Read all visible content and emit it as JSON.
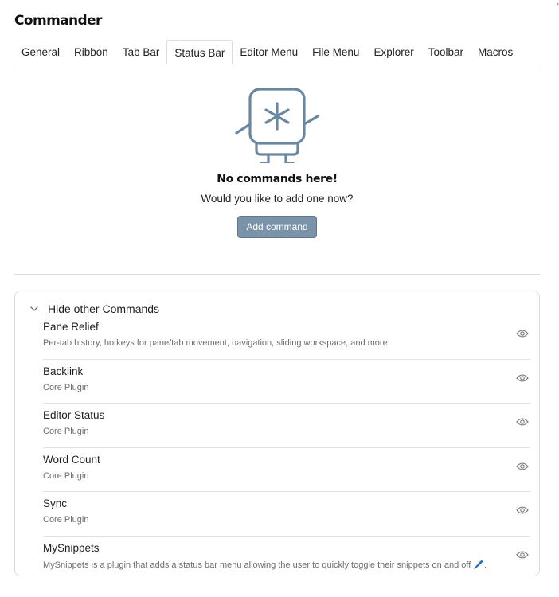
{
  "page": {
    "title": "Commander",
    "corner_mark": "‚"
  },
  "tabs": [
    {
      "label": "General",
      "active": false
    },
    {
      "label": "Ribbon",
      "active": false
    },
    {
      "label": "Tab Bar",
      "active": false
    },
    {
      "label": "Status Bar",
      "active": true
    },
    {
      "label": "Editor Menu",
      "active": false
    },
    {
      "label": "File Menu",
      "active": false
    },
    {
      "label": "Explorer",
      "active": false
    },
    {
      "label": "Toolbar",
      "active": false
    },
    {
      "label": "Macros",
      "active": false
    }
  ],
  "empty_state": {
    "title": "No commands here!",
    "subtitle": "Would you like to add one now?",
    "button_label": "Add command",
    "mascot_icon": "asterisk-robot-icon"
  },
  "other_commands": {
    "header": "Hide other Commands",
    "items": [
      {
        "name": "Pane Relief",
        "desc": "Per-tab history, hotkeys for pane/tab movement, navigation, sliding workspace, and more"
      },
      {
        "name": "Backlink",
        "desc": "Core Plugin"
      },
      {
        "name": "Editor Status",
        "desc": "Core Plugin"
      },
      {
        "name": "Word Count",
        "desc": "Core Plugin"
      },
      {
        "name": "Sync",
        "desc": "Core Plugin"
      },
      {
        "name": "MySnippets",
        "desc": "MySnippets is a plugin that adds a status bar menu allowing the user to quickly toggle their snippets on and off 🖊️."
      }
    ]
  },
  "colors": {
    "accent_button": "#7a93a8",
    "mascot_stroke": "#6a87a0",
    "divider": "#dcdcdc"
  }
}
